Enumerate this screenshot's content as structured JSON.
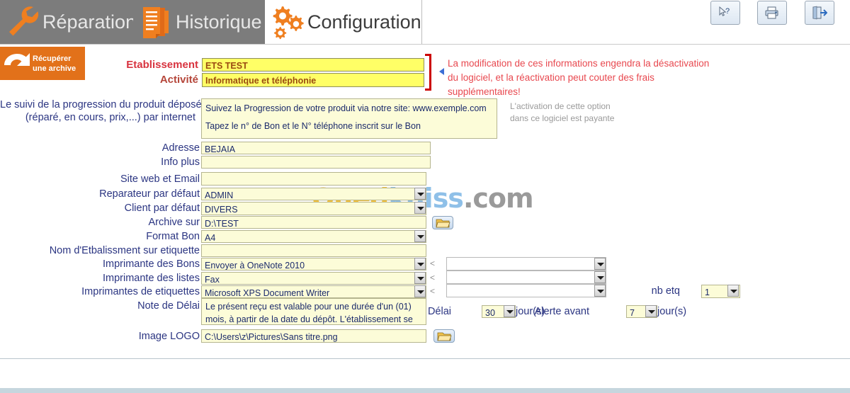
{
  "tabs": [
    {
      "label": "Réparation",
      "icon": "wrench-icon",
      "active": false
    },
    {
      "label": "Historique",
      "icon": "documents-icon",
      "active": false
    },
    {
      "label": "Configuration",
      "icon": "gears-icon",
      "active": true
    }
  ],
  "toolbar": {
    "help_icon": "cursor-question-icon",
    "print_icon": "printer-icon",
    "exit_icon": "exit-door-icon"
  },
  "archive_button": {
    "line1": "Récupérer",
    "line2": "une archive",
    "icon": "undo-arrow-icon"
  },
  "header": {
    "etablissement_label": "Etablissement",
    "etablissement_value": "ETS TEST",
    "activite_label": "Activité",
    "activite_value": "Informatique et téléphonie",
    "warning": "La modification de ces informations engendra la désactivation du logiciel, et la réactivation peut couter des frais supplémentaires!"
  },
  "tracking": {
    "label_line1": "Le suivi de la progression du produit déposé",
    "label_line2": "(réparé, en cours, prix,...) par internet",
    "text_line1": "Suivez la Progression de votre produit via notre site: www.exemple.com",
    "text_line2": "Tapez le n° de Bon et le N° téléphone inscrit sur le Bon",
    "side_note": "L'activation de cette option dans ce logiciel est payante"
  },
  "fields": {
    "adresse_label": "Adresse",
    "adresse_value": "BEJAIA",
    "info_plus_label": "Info plus",
    "info_plus_value": "",
    "site_web_label": "Site web et Email",
    "site_web_value": "",
    "reparateur_label": "Reparateur par défaut",
    "reparateur_value": "ADMIN",
    "client_label": "Client par défaut",
    "client_value": "DIVERS",
    "archive_label": "Archive sur",
    "archive_value": "D:\\TEST",
    "format_bon_label": "Format Bon",
    "format_bon_value": "A4",
    "nom_etiquette_label": "Nom d'Etbalissment sur etiquette",
    "nom_etiquette_value": "",
    "imp_bons_label": "Imprimante des Bons",
    "imp_bons_value": "Envoyer à OneNote 2010",
    "imp_listes_label": "Imprimante des listes",
    "imp_listes_value": "Fax",
    "imp_etiquettes_label": "Imprimantes de etiquettes",
    "imp_etiquettes_value": "Microsoft XPS Document Writer",
    "tray_marker": "<",
    "tray_bons_value": "",
    "tray_listes_value": "",
    "tray_etiquettes_value": "",
    "nb_etq_label": "nb etq",
    "nb_etq_value": "1",
    "note_delai_label": "Note de Délai",
    "note_delai_line1": "Le présent reçu est valable pour une durée d'un (01)",
    "note_delai_line2": "mois, à partir de la date du dépôt. L'établissement se",
    "delai_label": "Délai",
    "delai_value": "30",
    "delai_unit": "jour(s)",
    "alerte_label": "Alerte avant",
    "alerte_value": "7",
    "alerte_unit": "jour(s)",
    "logo_label": "Image LOGO",
    "logo_value": "C:\\Users\\z\\Pictures\\Sans titre.png",
    "browse_icon": "open-folder-icon"
  },
  "watermark": {
    "part1": "Oued",
    "part2": "kniss",
    "part3": ".com"
  },
  "colors": {
    "accent_orange": "#e2711a",
    "tab_gray": "#7c7c7c",
    "label_blue": "#2b3582",
    "field_yellow": "#fcfcd8",
    "highlight_yellow": "#ffff66",
    "warning_red": "#e8484f"
  }
}
